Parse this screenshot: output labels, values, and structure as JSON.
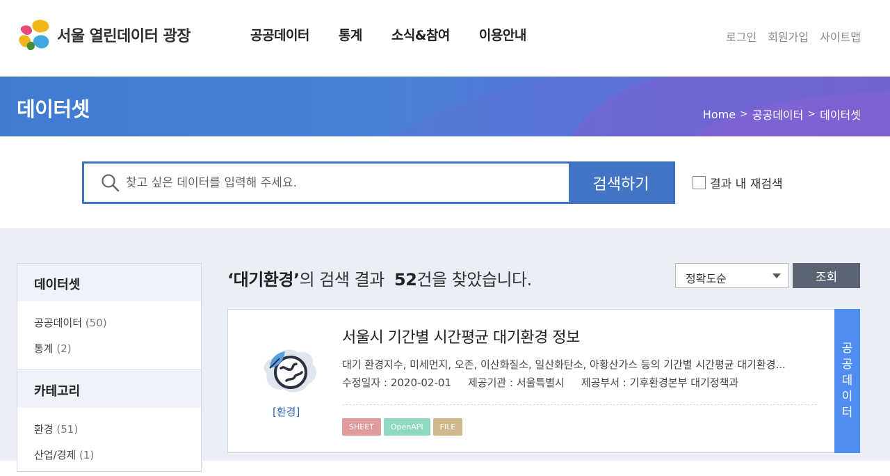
{
  "header": {
    "site_name": "서울 열린데이터 광장",
    "nav": [
      "공공데이터",
      "통계",
      "소식&참여",
      "이용안내"
    ],
    "util": [
      "로그인",
      "회원가입",
      "사이트맵"
    ]
  },
  "banner": {
    "title": "데이터셋",
    "breadcrumb": [
      "Home",
      "공공데이터",
      "데이터셋"
    ]
  },
  "search": {
    "placeholder": "찾고 싶은 데이터를 입력해 주세요.",
    "value": "",
    "button": "검색하기",
    "research_label": "결과 내 재검색",
    "research_checked": false
  },
  "sidebar": {
    "dataset_title": "데이터셋",
    "dataset_items": [
      {
        "label": "공공데이터",
        "count": "(50)"
      },
      {
        "label": "통계",
        "count": "(2)"
      }
    ],
    "category_title": "카테고리",
    "category_items": [
      {
        "label": "환경",
        "count": "(51)"
      },
      {
        "label": "산업/경제",
        "count": "(1)"
      }
    ]
  },
  "results": {
    "query": "대기환경",
    "prefix_quote": "‘",
    "suffix_quote": "’",
    "text_mid": "의 검색 결과",
    "count": "52",
    "text_end": "건을 찾았습니다.",
    "sort_value": "정확도순",
    "sort_button": "조회"
  },
  "card": {
    "category": "[환경]",
    "title": "서울시 기간별 시간평균 대기환경 정보",
    "description": "대기 환경지수, 미세먼지, 오존, 이산화질소, 일산화탄소, 아황산가스 등의 기간별 시간평균 대기환경...",
    "meta": {
      "modified_label": "수정일자 :",
      "modified_value": "2020-02-01",
      "provider_label": "제공기관 :",
      "provider_value": "서울특별시",
      "dept_label": "제공부서 :",
      "dept_value": "기후환경본부 대기정책과"
    },
    "tags": [
      "SHEET",
      "OpenAPI",
      "FILE"
    ],
    "side_label": [
      "공",
      "공",
      "데",
      "이",
      "터"
    ]
  },
  "colors": {
    "primary": "#4474c4",
    "banner_start": "#3f7bd0",
    "banner_end": "#7156cf",
    "card_side": "#4f8ef0",
    "content_bg": "#e9eef7"
  }
}
